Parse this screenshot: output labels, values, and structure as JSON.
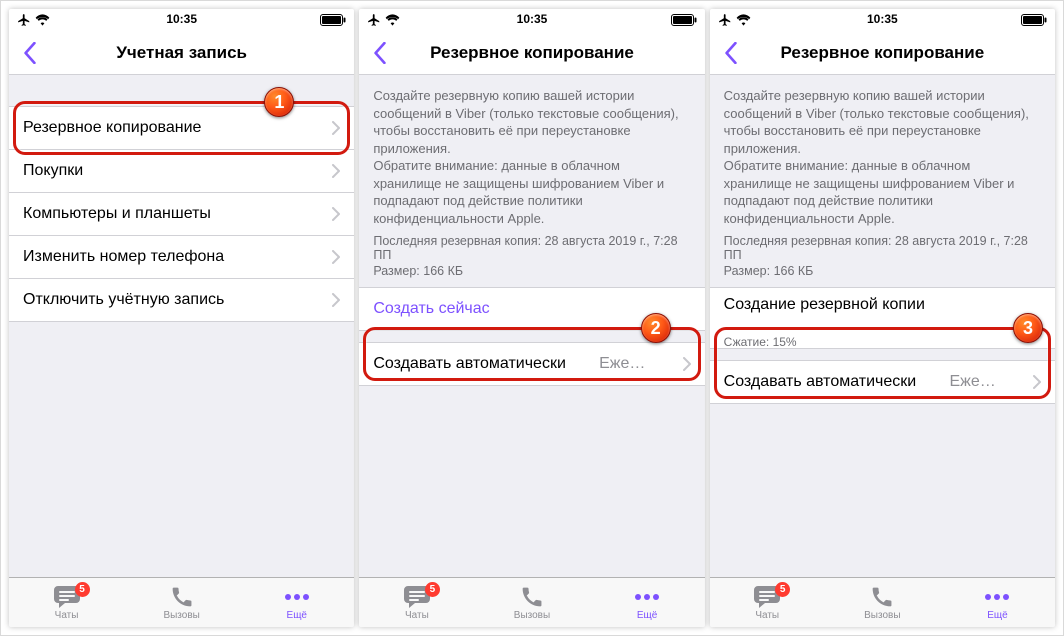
{
  "status": {
    "time": "10:35"
  },
  "screens": [
    {
      "title": "Учетная запись",
      "items": [
        {
          "label": "Резервное копирование",
          "highlight": true
        },
        {
          "label": "Покупки"
        },
        {
          "label": "Компьютеры и планшеты"
        },
        {
          "label": "Изменить номер телефона"
        },
        {
          "label": "Отключить учётную запись"
        }
      ],
      "ball": "1"
    },
    {
      "title": "Резервное копирование",
      "description": "Создайте резервную копию вашей истории сообщений в Viber (только текстовые сообщения), чтобы восстановить её при переустановке приложения.\nОбратите внимание: данные в облачном хранилище не защищены шифрованием Viber и подпадают под действие политики конфиденциальности Apple.",
      "last_backup": "Последняя резервная копия: 28 августа 2019 г., 7:28 ПП",
      "size": "Размер: 166 КБ",
      "create_now": "Создать сейчас",
      "auto_label": "Создавать автоматически",
      "auto_value": "Еже…",
      "ball": "2"
    },
    {
      "title": "Резервное копирование",
      "description": "Создайте резервную копию вашей истории сообщений в Viber (только текстовые сообщения), чтобы восстановить её при переустановке приложения.\nОбратите внимание: данные в облачном хранилище не защищены шифрованием Viber и подпадают под действие политики конфиденциальности Apple.",
      "last_backup": "Последняя резервная копия: 28 августа 2019 г., 7:28 ПП",
      "size": "Размер: 166 КБ",
      "progress_title": "Создание резервной копии",
      "progress_sub": "Сжатие: 15%",
      "auto_label": "Создавать автоматически",
      "auto_value": "Еже…",
      "ball": "3"
    }
  ],
  "tabs": {
    "chats": "Чаты",
    "calls": "Вызовы",
    "more": "Ещё",
    "badge": "5"
  }
}
